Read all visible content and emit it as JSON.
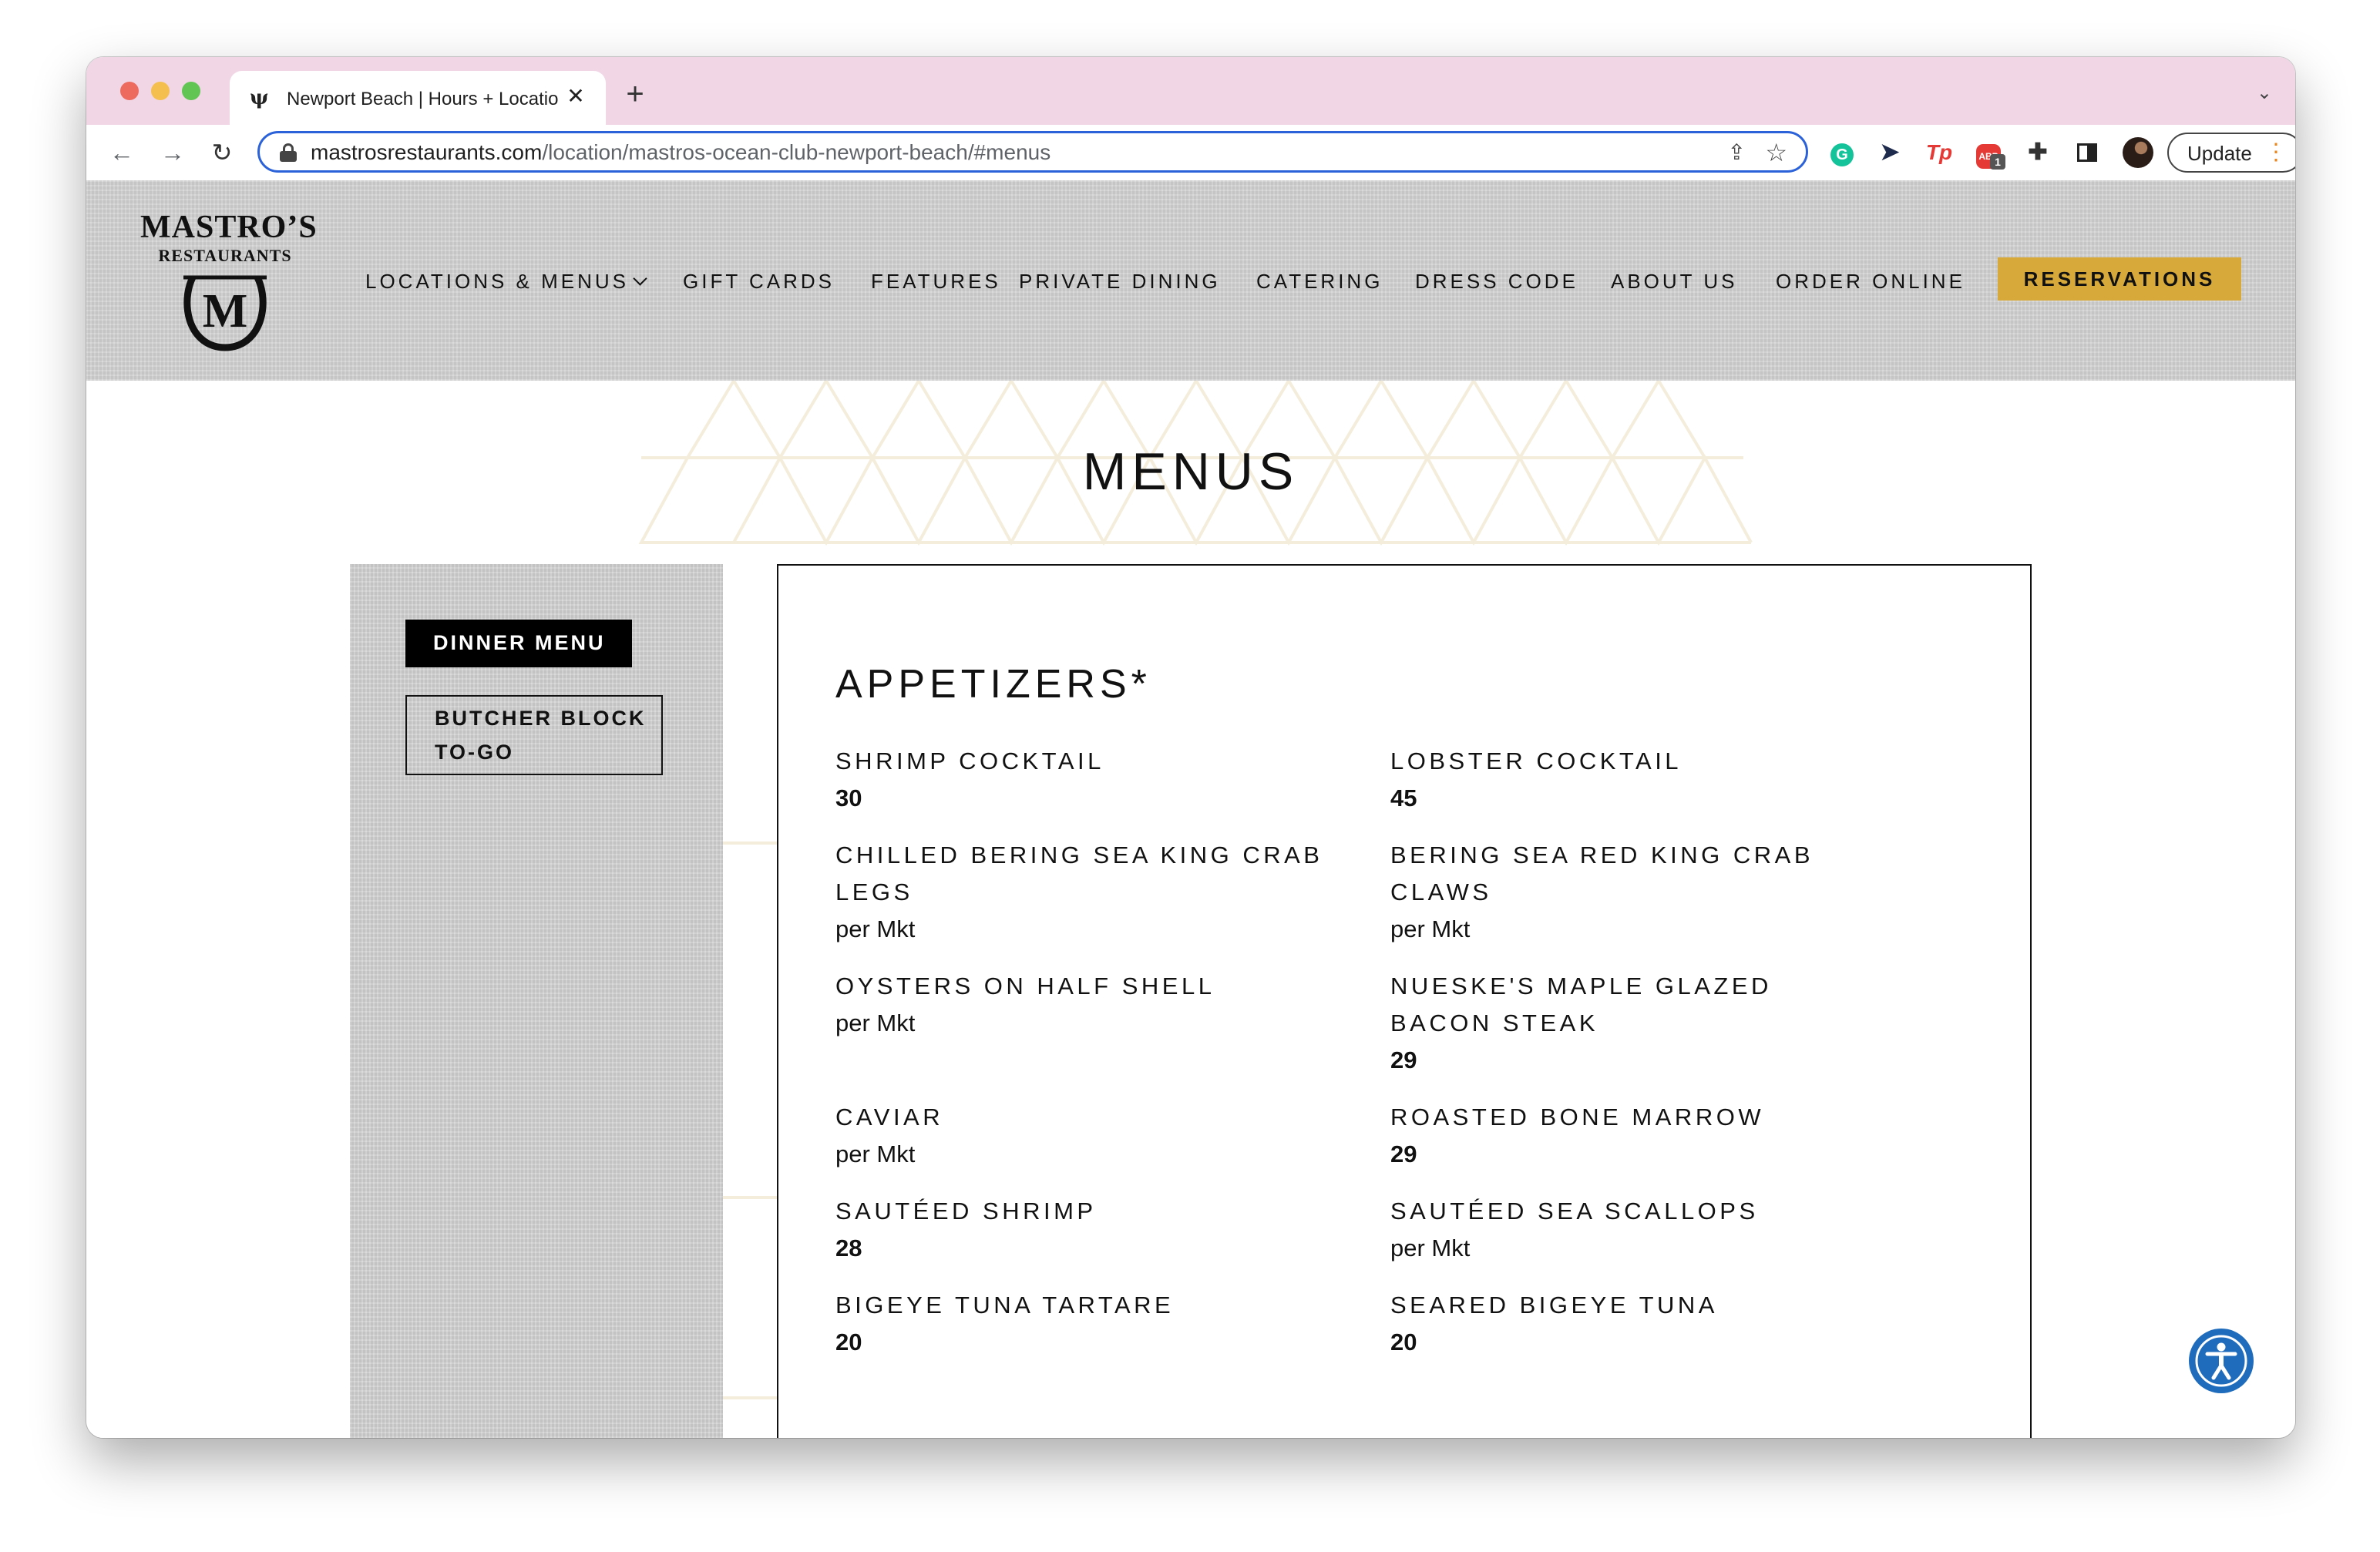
{
  "browser": {
    "tab_title": "Newport Beach | Hours + Location",
    "tab_favicon": "ψ",
    "url_host": "mastrosrestaurants.com",
    "url_path": "/location/mastros-ocean-club-newport-beach/#menus",
    "update_label": "Update",
    "extensions": [
      "grammarly-icon",
      "cursor-extension-icon",
      "tp-extension-icon",
      "adblock-icon",
      "puzzle-icon",
      "side-panel-icon"
    ],
    "adblock_badge": "1",
    "tp_label": "Tp",
    "grammarly_label": "G",
    "adblock_label": "ABP"
  },
  "site": {
    "logo_wordmark": "MASTRO’S",
    "logo_subtitle": "RESTAURANTS",
    "logo_letter": "M",
    "nav": [
      "LOCATIONS & MENUS",
      "GIFT CARDS",
      "FEATURES",
      "PRIVATE DINING",
      "CATERING",
      "DRESS CODE",
      "ABOUT US",
      "ORDER ONLINE"
    ],
    "reservations_label": "RESERVATIONS",
    "colors": {
      "accent_gold": "#d7a93a",
      "header_gray": "#d2d2d2",
      "accessibility_blue": "#1f6cbd"
    }
  },
  "menus": {
    "title": "MENUS",
    "sidebar": [
      "DINNER MENU",
      "BUTCHER BLOCK\nTO-GO"
    ],
    "section_title": "APPETIZERS*",
    "items": [
      {
        "name": "SHRIMP COCKTAIL",
        "price": "30"
      },
      {
        "name": "LOBSTER COCKTAIL",
        "price": "45"
      },
      {
        "name": "CHILLED BERING SEA KING CRAB LEGS",
        "price": "per Mkt"
      },
      {
        "name": "BERING SEA RED KING CRAB CLAWS",
        "price": "per Mkt"
      },
      {
        "name": "OYSTERS ON HALF SHELL",
        "price": "per Mkt"
      },
      {
        "name": "NUESKE'S MAPLE GLAZED BACON STEAK",
        "price": "29"
      },
      {
        "name": "CAVIAR",
        "price": "per Mkt"
      },
      {
        "name": "ROASTED BONE MARROW",
        "price": "29"
      },
      {
        "name": "SAUTÉED SHRIMP",
        "price": "28"
      },
      {
        "name": "SAUTÉED SEA SCALLOPS",
        "price": "per Mkt"
      },
      {
        "name": "BIGEYE TUNA TARTARE",
        "price": "20"
      },
      {
        "name": "SEARED BIGEYE TUNA",
        "price": "20"
      }
    ]
  }
}
